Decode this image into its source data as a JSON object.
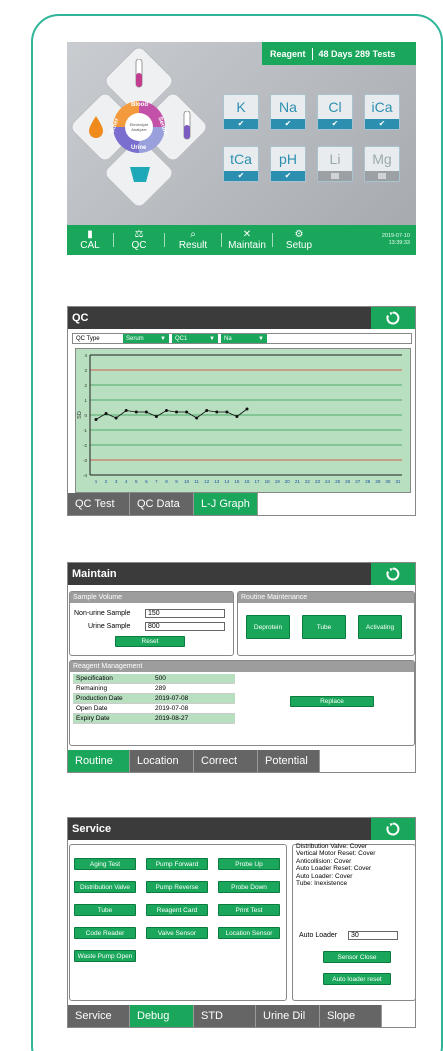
{
  "home": {
    "reagent_label": "Reagent",
    "reagent_status": "48 Days 289 Tests",
    "wheel": {
      "center": "Electrolyte Analyzer",
      "blood": "Blood",
      "serum": "Serum",
      "urine": "Urine",
      "other": "Other"
    },
    "tiles": [
      {
        "label": "K",
        "on": true
      },
      {
        "label": "Na",
        "on": true
      },
      {
        "label": "Cl",
        "on": true
      },
      {
        "label": "iCa",
        "on": true
      },
      {
        "label": "tCa",
        "on": true
      },
      {
        "label": "pH",
        "on": true
      },
      {
        "label": "Li",
        "on": false
      },
      {
        "label": "Mg",
        "on": false
      }
    ],
    "bottom": [
      "CAL",
      "QC",
      "Result",
      "Maintain",
      "Setup"
    ],
    "date": "2019-07-10",
    "time": "13:39:33"
  },
  "qc": {
    "title": "QC",
    "type_label": "QC Type",
    "type_value": "Serum",
    "level_value": "QC1",
    "item_value": "Na",
    "ylabel": "SD",
    "tabs": [
      "QC Test",
      "QC Data",
      "L-J Graph"
    ],
    "active_tab": 2
  },
  "chart_data": {
    "type": "line",
    "ylabel": "SD",
    "ylim": [
      -4,
      4
    ],
    "yticks": [
      4,
      3,
      2,
      1,
      0,
      -1,
      -2,
      -3,
      -4
    ],
    "x": [
      1,
      2,
      3,
      4,
      5,
      6,
      7,
      8,
      9,
      10,
      11,
      12,
      13,
      14,
      15,
      16,
      17,
      18,
      19,
      20,
      21,
      22,
      23,
      24,
      25,
      26,
      27,
      28,
      29,
      30,
      31
    ],
    "series": [
      {
        "values": [
          -0.3,
          0.1,
          -0.2,
          0.3,
          0.2,
          0.2,
          -0.1,
          0.3,
          0.2,
          0.2,
          -0.2,
          0.3,
          0.2,
          0.2,
          -0.1,
          0.4
        ]
      }
    ],
    "grid": true
  },
  "maintain": {
    "title": "Maintain",
    "sample_title": "Sample Volume",
    "nonurine_label": "Non-urine Sample",
    "nonurine_value": "150",
    "urine_label": "Urine Sample",
    "urine_value": "800",
    "reset": "Reset",
    "routine_title": "Routine Maintenance",
    "routine_buttons": [
      "Deprotein",
      "Tube",
      "Activating"
    ],
    "reagent_title": "Reagent Management",
    "rows": [
      {
        "k": "Specification",
        "v": "500"
      },
      {
        "k": "Remaining",
        "v": "289"
      },
      {
        "k": "Production Date",
        "v": "2019-07-08"
      },
      {
        "k": "Open Date",
        "v": "2019-07-08"
      },
      {
        "k": "Expiry Date",
        "v": "2019-08-27"
      }
    ],
    "replace": "Replace",
    "tabs": [
      "Routine",
      "Location",
      "Correct",
      "Potential"
    ],
    "active_tab": 0
  },
  "service": {
    "title": "Service",
    "buttons": [
      "Aging Test",
      "Pump Forward",
      "Probe Up",
      "Distribution Valve",
      "Pump Reverse",
      "Probe Down",
      "Tube",
      "Reagent Card",
      "Print Test",
      "Code Reader",
      "Valve Sensor",
      "Location Sensor",
      "Waste Pump Open"
    ],
    "status": [
      "Distribution Valve: Cover",
      "Vertical Motor Reset: Cover",
      "Anticollision: Cover",
      "Auto Loader Reset: Cover",
      "Auto Loader: Cover",
      "Tube: Inexistence"
    ],
    "auto_loader_label": "Auto Loader",
    "auto_loader_value": "30",
    "sensor_close": "Sensor Close",
    "auto_loader_reset": "Auto loader reset",
    "tabs": [
      "Service",
      "Debug",
      "STD",
      "Urine Dil",
      "Slope"
    ],
    "active_tab": 1
  }
}
